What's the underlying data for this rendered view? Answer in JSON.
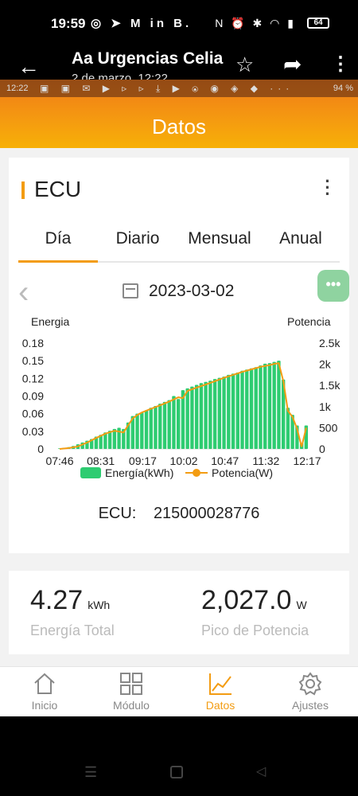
{
  "status_bar": {
    "time": "19:59",
    "app_icons": "◎ ➤ M in B.",
    "system_icons": "N ⏰ ✱ ◠ ▮",
    "battery": "64"
  },
  "chat_header": {
    "back_icon": "arrow-left-icon",
    "title": "Aa Urgencias Celia",
    "subtitle": "2 de marzo, 12:22",
    "star_icon": "star-icon",
    "share_icon": "share-icon",
    "more_icon": "more-vert-icon"
  },
  "inner_status": {
    "time": "12:22",
    "icons": "▣ ▣ ✉ ▶ ▹ ▹ ⤓ ▶ ⦿ ◉ ◈ ◆ ···",
    "battery": "94 %"
  },
  "app": {
    "header_title": "Datos",
    "ecu": {
      "title": "ECU",
      "tabs": [
        "Día",
        "Diario",
        "Mensual",
        "Anual"
      ],
      "active_tab": "Día",
      "date": "2023-03-02",
      "id_label": "ECU:",
      "id_value": "215000028776"
    },
    "stats": {
      "energy_value": "4.27",
      "energy_unit": "kWh",
      "energy_label": "Energía Total",
      "peak_value": "2,027.0",
      "peak_unit": "W",
      "peak_label": "Pico de Potencia"
    },
    "nav": [
      {
        "label": "Inicio",
        "icon": "home-icon"
      },
      {
        "label": "Módulo",
        "icon": "grid-icon"
      },
      {
        "label": "Datos",
        "icon": "chart-line-icon"
      },
      {
        "label": "Ajustes",
        "icon": "gear-icon"
      }
    ],
    "active_nav": "Datos",
    "colors": {
      "accent": "#f39c12",
      "bar": "#2ecc71",
      "line": "#f39c12"
    }
  },
  "chart_data": {
    "type": "bar",
    "left_axis_title": "Energia",
    "right_axis_title": "Potencia",
    "x_ticks": [
      "07:46",
      "08:31",
      "09:17",
      "10:02",
      "10:47",
      "11:32",
      "12:17"
    ],
    "y_left_ticks": [
      "0",
      "0.03",
      "0.06",
      "0.09",
      "0.12",
      "0.15",
      "0.18"
    ],
    "y_right_ticks": [
      "0",
      "500",
      "1k",
      "1.5k",
      "2k",
      "2.5k"
    ],
    "ylim_left": [
      0,
      0.18
    ],
    "ylim_right": [
      0,
      2500
    ],
    "legend": [
      "Energía(kWh)",
      "Potencia(W)"
    ],
    "x_minutes_start": 466,
    "x_minutes_end": 737,
    "series": [
      {
        "name": "Energía(kWh)",
        "kind": "bar",
        "x": [
          "07:46",
          "07:51",
          "07:56",
          "08:01",
          "08:06",
          "08:11",
          "08:16",
          "08:21",
          "08:26",
          "08:31",
          "08:36",
          "08:41",
          "08:46",
          "08:51",
          "08:56",
          "09:01",
          "09:06",
          "09:11",
          "09:16",
          "09:21",
          "09:26",
          "09:31",
          "09:36",
          "09:41",
          "09:46",
          "09:51",
          "09:56",
          "10:01",
          "10:06",
          "10:11",
          "10:16",
          "10:21",
          "10:26",
          "10:31",
          "10:36",
          "10:41",
          "10:46",
          "10:51",
          "10:56",
          "11:01",
          "11:06",
          "11:11",
          "11:16",
          "11:21",
          "11:26",
          "11:31",
          "11:36",
          "11:41",
          "11:46",
          "11:51",
          "11:56",
          "12:01",
          "12:06",
          "12:11",
          "12:16"
        ],
        "values": [
          0.001,
          0.002,
          0.003,
          0.005,
          0.008,
          0.011,
          0.014,
          0.017,
          0.021,
          0.024,
          0.028,
          0.031,
          0.034,
          0.036,
          0.034,
          0.045,
          0.056,
          0.06,
          0.062,
          0.066,
          0.07,
          0.073,
          0.077,
          0.08,
          0.083,
          0.09,
          0.085,
          0.1,
          0.103,
          0.106,
          0.109,
          0.112,
          0.114,
          0.116,
          0.119,
          0.121,
          0.123,
          0.126,
          0.128,
          0.13,
          0.133,
          0.135,
          0.137,
          0.139,
          0.142,
          0.145,
          0.146,
          0.148,
          0.15,
          0.118,
          0.07,
          0.058,
          0.04,
          0.01,
          0.04
        ]
      },
      {
        "name": "Potencia(W)",
        "kind": "line",
        "x": [
          "07:46",
          "07:56",
          "08:06",
          "08:16",
          "08:26",
          "08:36",
          "08:46",
          "08:51",
          "08:56",
          "09:01",
          "09:06",
          "09:11",
          "09:16",
          "09:26",
          "09:36",
          "09:46",
          "09:56",
          "10:01",
          "10:06",
          "10:16",
          "10:26",
          "10:36",
          "10:46",
          "10:56",
          "11:06",
          "11:16",
          "11:26",
          "11:36",
          "11:41",
          "11:46",
          "11:51",
          "11:56",
          "12:01",
          "12:06",
          "12:11",
          "12:16"
        ],
        "values": [
          0,
          20,
          60,
          150,
          260,
          360,
          430,
          410,
          390,
          560,
          720,
          800,
          860,
          950,
          1030,
          1120,
          1220,
          1200,
          1370,
          1450,
          1520,
          1600,
          1680,
          1750,
          1820,
          1880,
          1940,
          1980,
          2010,
          2027,
          1600,
          900,
          760,
          480,
          50,
          500
        ]
      }
    ]
  }
}
